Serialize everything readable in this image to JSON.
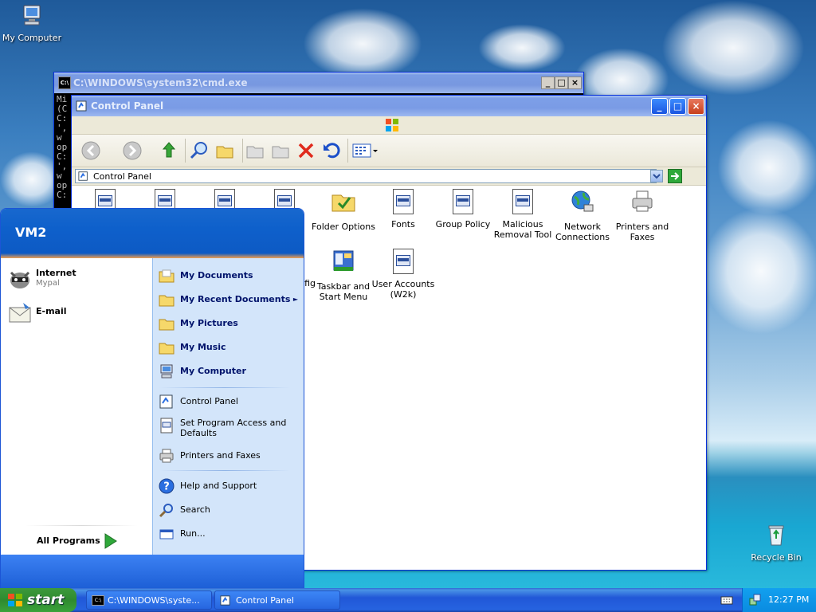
{
  "desktop": {
    "icons": [
      {
        "label": "My Computer",
        "icon": "my-computer-icon"
      },
      {
        "label": "Recycle Bin",
        "icon": "recycle-bin-icon"
      }
    ]
  },
  "cmd_window": {
    "title": "C:\\WINDOWS\\system32\\cmd.exe",
    "lines": [
      "Mi",
      "(C",
      "",
      "C:",
      "',",
      "w",
      "op",
      "",
      "C:",
      "',",
      "w",
      "op",
      "C:"
    ],
    "buttons": [
      "_",
      "□",
      "×"
    ]
  },
  "control_panel": {
    "title": "Control Panel",
    "address": "Control Panel",
    "items": [
      {
        "label": "",
        "icon": "applet-icon"
      },
      {
        "label": "",
        "icon": "applet-icon"
      },
      {
        "label": "",
        "icon": "applet-icon"
      },
      {
        "label": "",
        "icon": "applet-icon"
      },
      {
        "label": "Folder Options",
        "icon": "folder-options-icon"
      },
      {
        "label": "Fonts",
        "icon": "applet-icon"
      },
      {
        "label": "Group Policy",
        "icon": "applet-icon"
      },
      {
        "label": "Malicious Removal Tool",
        "icon": "applet-icon"
      },
      {
        "label": "Network Connections",
        "icon": "network-icon"
      },
      {
        "label": "Printers and Faxes",
        "icon": "printer-icon"
      },
      {
        "label": "fig",
        "icon": "none"
      },
      {
        "label": "Taskbar and Start Menu",
        "icon": "taskbar-icon"
      },
      {
        "label": "User Accounts (W2k)",
        "icon": "applet-icon"
      }
    ]
  },
  "start_menu": {
    "user": "VM2",
    "pinned": [
      {
        "label": "Internet",
        "sub": "Mypal",
        "icon": "raccoon-browser-icon"
      },
      {
        "label": "E-mail",
        "sub": "",
        "icon": "email-icon"
      }
    ],
    "all_programs": "All Programs",
    "right": [
      {
        "label": "My Documents",
        "bold": true,
        "icon": "folder-icon"
      },
      {
        "label": "My Recent Documents",
        "bold": true,
        "icon": "folder-icon",
        "arrow": "►"
      },
      {
        "label": "My Pictures",
        "bold": true,
        "icon": "folder-icon"
      },
      {
        "label": "My Music",
        "bold": true,
        "icon": "folder-icon"
      },
      {
        "label": "My Computer",
        "bold": true,
        "icon": "my-computer-icon"
      },
      {
        "label": "Control Panel",
        "bold": false,
        "icon": "control-panel-icon"
      },
      {
        "label": "Set Program Access and Defaults",
        "bold": false,
        "icon": "applet-icon"
      },
      {
        "label": "Printers and Faxes",
        "bold": false,
        "icon": "printer-icon"
      },
      {
        "label": "Help and Support",
        "bold": false,
        "icon": "help-icon"
      },
      {
        "label": "Search",
        "bold": false,
        "icon": "search-icon"
      },
      {
        "label": "Run...",
        "bold": false,
        "icon": "run-icon"
      }
    ]
  },
  "taskbar": {
    "start_label": "start",
    "tasks": [
      {
        "label": "C:\\WINDOWS\\syste...",
        "icon": "cmd-icon"
      },
      {
        "label": "Control Panel",
        "icon": "control-panel-icon"
      }
    ],
    "clock": "12:27 PM"
  },
  "colors": {
    "xp_blue": "#0053ee",
    "start_green": "#2f8a2f"
  }
}
